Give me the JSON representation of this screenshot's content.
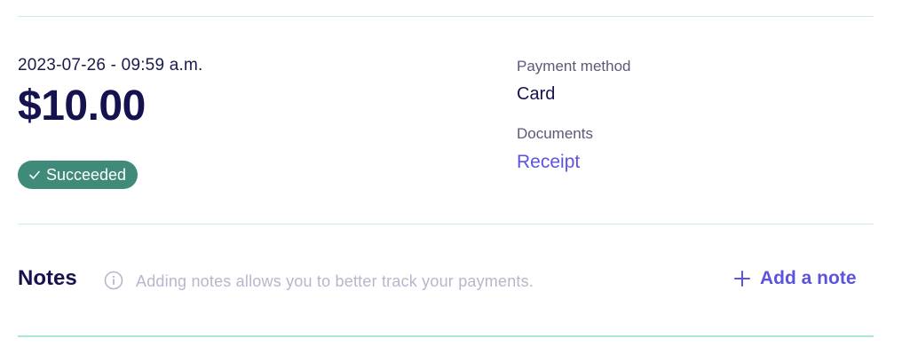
{
  "payment": {
    "datetime": "2023-07-26 - 09:59 a.m.",
    "amount": "$10.00",
    "status": "Succeeded"
  },
  "details": {
    "payment_method_label": "Payment method",
    "payment_method_value": "Card",
    "documents_label": "Documents",
    "documents_link": "Receipt"
  },
  "notes": {
    "title": "Notes",
    "hint": "Adding notes allows you to better track your payments.",
    "add_label": "Add a note"
  },
  "colors": {
    "status_bg": "#3f8a78",
    "accent": "#5b54e0",
    "divider": "#c9ece4"
  },
  "icons": [
    "check-icon",
    "info-icon",
    "plus-icon"
  ]
}
